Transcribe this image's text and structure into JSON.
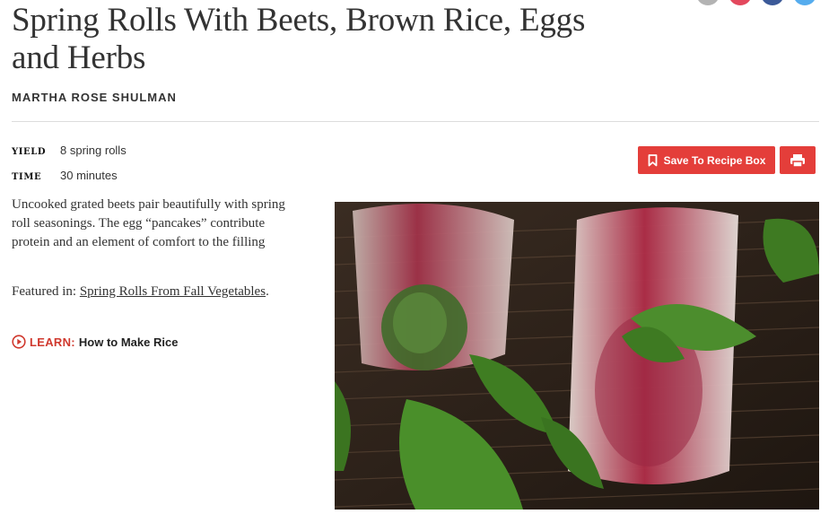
{
  "recipe": {
    "title": "Spring Rolls With Beets, Brown Rice, Eggs and Herbs",
    "author": "MARTHA ROSE SHULMAN"
  },
  "meta": {
    "yield_label": "YIELD",
    "yield_value": "8 spring rolls",
    "time_label": "TIME",
    "time_value": "30 minutes"
  },
  "actions": {
    "save_label": "Save To Recipe Box",
    "bookmark_icon": "bookmark-icon",
    "print_icon": "printer-icon"
  },
  "description": "Uncooked grated beets pair beautifully with spring roll seasonings. The egg “pancakes” contribute protein and an element of comfort to the filling",
  "featured": {
    "prefix": "Featured in:",
    "link_text": "Spring Rolls From Fall Vegetables",
    "suffix": "."
  },
  "learn": {
    "icon": "play-circle-icon",
    "kicker": "LEARN:",
    "link_text": "How to Make Rice"
  },
  "share_colors": [
    "#b3b3b3",
    "#e3485d",
    "#3b5998",
    "#55acee"
  ],
  "accent_color": "#e43e3a"
}
